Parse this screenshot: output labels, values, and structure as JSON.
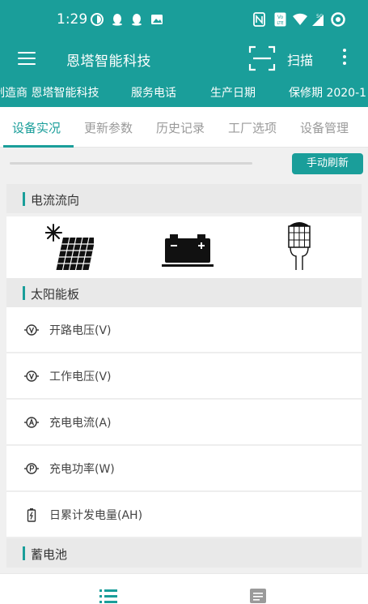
{
  "status_bar": {
    "time": "1:29",
    "network": "5G"
  },
  "app_bar": {
    "title": "恩塔智能科技",
    "scan_label": "扫描"
  },
  "info_bar": {
    "items": [
      "制造商 恩塔智能科技",
      "服务电话",
      "生产日期",
      "保修期 2020-1"
    ]
  },
  "tabs": [
    {
      "label": "设备实况",
      "active": true
    },
    {
      "label": "更新参数",
      "active": false
    },
    {
      "label": "历史记录",
      "active": false
    },
    {
      "label": "工厂选项",
      "active": false
    },
    {
      "label": "设备管理",
      "active": false
    }
  ],
  "toolbar": {
    "refresh_label": "手动刷新"
  },
  "sections": {
    "flow": "电流流向",
    "solar": "太阳能板",
    "battery": "蓄电池"
  },
  "solar_rows": [
    {
      "icon": "voltage-icon",
      "label": "开路电压(V)"
    },
    {
      "icon": "voltage-icon",
      "label": "工作电压(V)"
    },
    {
      "icon": "ampere-icon",
      "label": "充电电流(A)"
    },
    {
      "icon": "power-icon",
      "label": "充电功率(W)"
    },
    {
      "icon": "battery-charge-icon",
      "label": "日累计发电量(AH)"
    }
  ],
  "colors": {
    "accent": "#1a9e9a"
  }
}
